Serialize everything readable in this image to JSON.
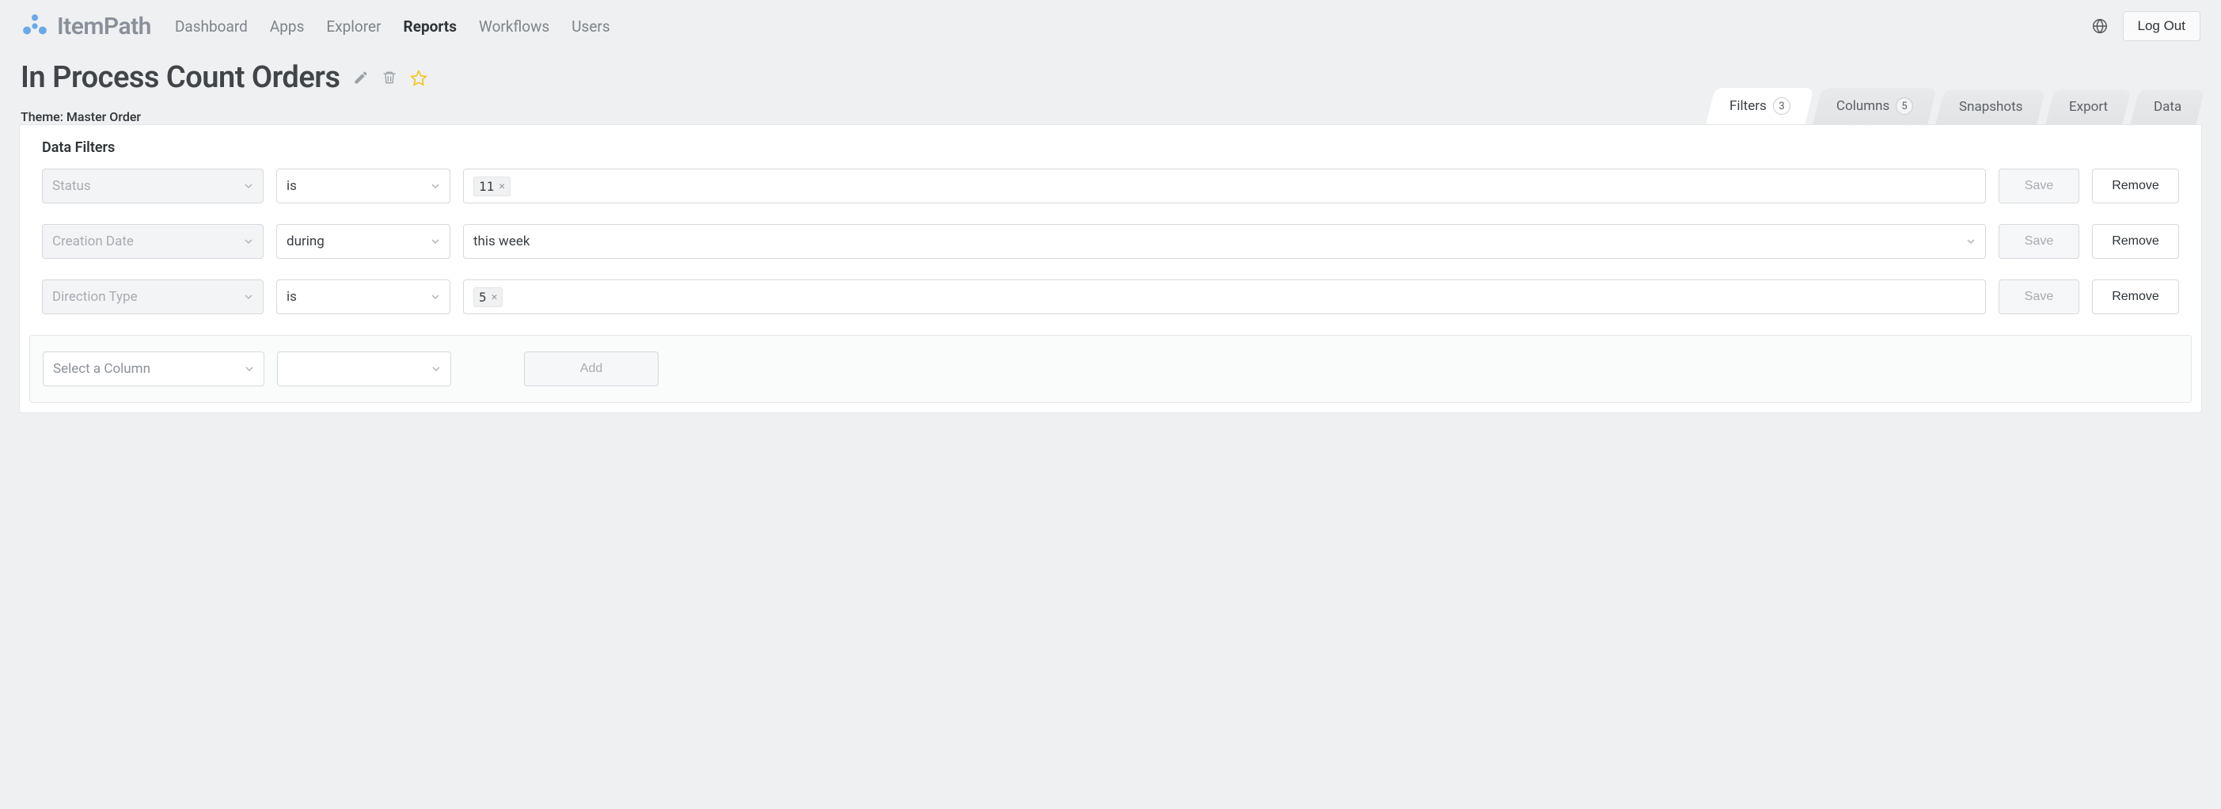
{
  "brand": {
    "name": "ItemPath"
  },
  "nav": {
    "items": [
      {
        "label": "Dashboard",
        "active": false
      },
      {
        "label": "Apps",
        "active": false
      },
      {
        "label": "Explorer",
        "active": false
      },
      {
        "label": "Reports",
        "active": true
      },
      {
        "label": "Workflows",
        "active": false
      },
      {
        "label": "Users",
        "active": false
      }
    ],
    "logout": "Log Out"
  },
  "page": {
    "title": "In Process Count Orders",
    "theme_prefix": "Theme: ",
    "theme_name": "Master Order"
  },
  "tabs": [
    {
      "label": "Filters",
      "badge": "3",
      "active": true
    },
    {
      "label": "Columns",
      "badge": "5",
      "active": false
    },
    {
      "label": "Snapshots",
      "badge": null,
      "active": false
    },
    {
      "label": "Export",
      "badge": null,
      "active": false
    },
    {
      "label": "Data",
      "badge": null,
      "active": false
    }
  ],
  "filters": {
    "section_title": "Data Filters",
    "rows": [
      {
        "column": "Status",
        "verb": "is",
        "value_tag": "11",
        "value_select": null,
        "save": "Save",
        "remove": "Remove"
      },
      {
        "column": "Creation Date",
        "verb": "during",
        "value_tag": null,
        "value_select": "this week",
        "save": "Save",
        "remove": "Remove"
      },
      {
        "column": "Direction Type",
        "verb": "is",
        "value_tag": "5",
        "value_select": null,
        "save": "Save",
        "remove": "Remove"
      }
    ],
    "add": {
      "placeholder": "Select a Column",
      "button": "Add"
    }
  }
}
